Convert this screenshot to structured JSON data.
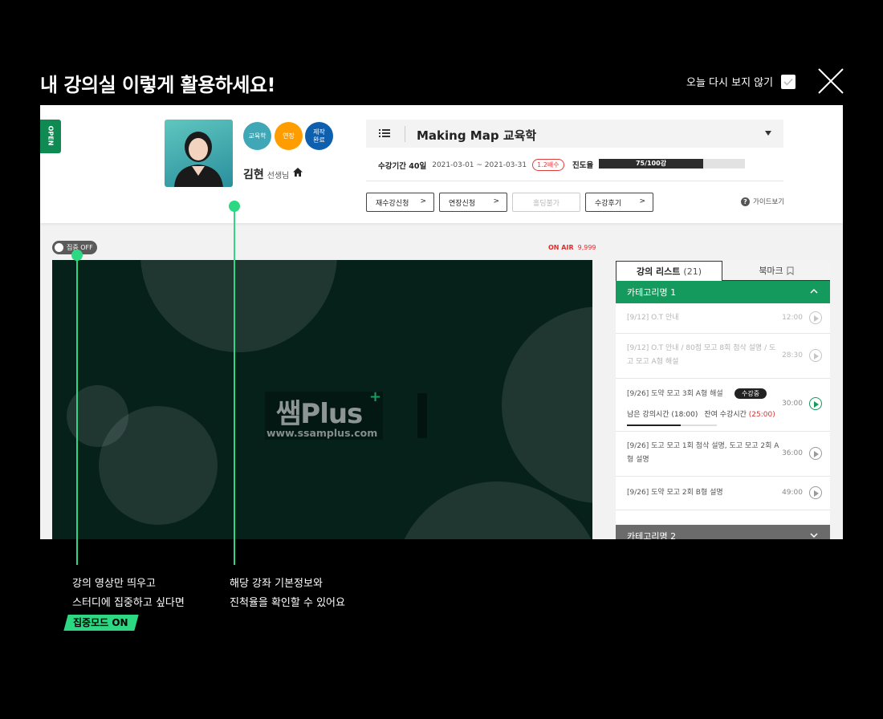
{
  "modal": {
    "title": "내 강의실 이렇게 활용하세요!",
    "dont_show_label": "오늘 다시 보지 않기"
  },
  "header": {
    "open_tab": "OPEN",
    "badges": [
      "교육학",
      "연장",
      "제작\n완료"
    ],
    "teacher_name": "김현",
    "teacher_suffix": "선생님",
    "course_title": "Making Map 교육학",
    "period_label": "수강기간 40일",
    "period_range": "2021-03-01 ~ 2021-03-31",
    "speed_tag": "1.2배수",
    "progress_label": "진도율",
    "progress_text": "75/100강",
    "progress_ratio": 0.75,
    "buttons": [
      "재수강신청",
      "연장신청",
      "홀딩불가",
      "수강후기"
    ],
    "guide_label": "가이드보기"
  },
  "player": {
    "focus_toggle": "집중 OFF",
    "onair_label": "ON AIR",
    "onair_count": "9,999",
    "logo_text": "쌤Plus",
    "logo_plus": "+",
    "logo_url": "www.ssamplus.com"
  },
  "sidebar": {
    "tab_list": "강의 리스트",
    "tab_list_count": "(21)",
    "tab_bookmark": "북마크",
    "category1": "카테고리명 1",
    "category2": "카테고리명 2",
    "items": [
      {
        "title": "[9/12] O.T 안내",
        "duration": "12:00"
      },
      {
        "title": "[9/12] O.T 안내 / 80점 모고 8회 첨삭 설명 / 도고 모고 A형 해설",
        "duration": "28:30"
      },
      {
        "title": "[9/26] 도약 모고 3회 A형 해설",
        "duration": "30:00",
        "status": "수강중",
        "remaining_label": "남은 강의시간 (18:00)",
        "left_label": "잔여 수강시간",
        "left_value": "(25:00)",
        "progress_ratio": 0.6
      },
      {
        "title": "[9/26] 도고 모고 1회 첨삭 설명, 도고 모고 2회 A형 설명",
        "duration": "36:00"
      },
      {
        "title": "[9/26] 도약 모고 2회 B형 설명",
        "duration": "49:00"
      }
    ]
  },
  "notes": {
    "left_line1": "강의 영상만 띄우고",
    "left_line2": "스터디에 집중하고 싶다면",
    "left_tag": "집중모드 ON",
    "right_line1": "해당 강좌 기본정보와",
    "right_line2": "진척율을 확인할 수 있어요"
  },
  "colors": {
    "accent_green": "#2dd882",
    "category_green": "#149a5c",
    "alert_red": "#e02e2e"
  }
}
